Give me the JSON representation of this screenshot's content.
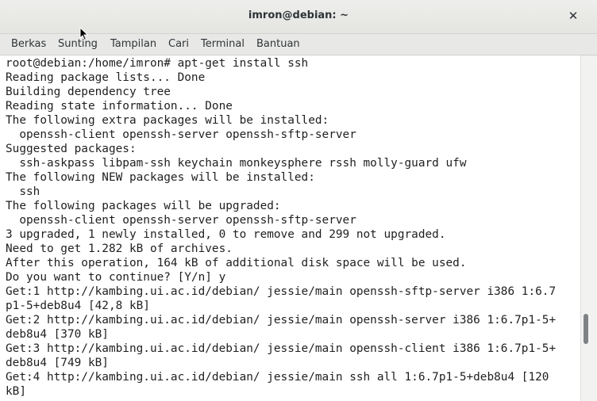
{
  "window": {
    "title": "imron@debian: ~",
    "close_label": "✕"
  },
  "menu": [
    "Berkas",
    "Sunting",
    "Tampilan",
    "Cari",
    "Terminal",
    "Bantuan"
  ],
  "terminal": {
    "lines": [
      "root@debian:/home/imron# apt-get install ssh",
      "Reading package lists... Done",
      "Building dependency tree",
      "Reading state information... Done",
      "The following extra packages will be installed:",
      "  openssh-client openssh-server openssh-sftp-server",
      "Suggested packages:",
      "  ssh-askpass libpam-ssh keychain monkeysphere rssh molly-guard ufw",
      "The following NEW packages will be installed:",
      "  ssh",
      "The following packages will be upgraded:",
      "  openssh-client openssh-server openssh-sftp-server",
      "3 upgraded, 1 newly installed, 0 to remove and 299 not upgraded.",
      "Need to get 1.282 kB of archives.",
      "After this operation, 164 kB of additional disk space will be used.",
      "Do you want to continue? [Y/n] y",
      "Get:1 http://kambing.ui.ac.id/debian/ jessie/main openssh-sftp-server i386 1:6.7",
      "p1-5+deb8u4 [42,8 kB]",
      "Get:2 http://kambing.ui.ac.id/debian/ jessie/main openssh-server i386 1:6.7p1-5+",
      "deb8u4 [370 kB]",
      "Get:3 http://kambing.ui.ac.id/debian/ jessie/main openssh-client i386 1:6.7p1-5+",
      "deb8u4 [749 kB]",
      "Get:4 http://kambing.ui.ac.id/debian/ jessie/main ssh all 1:6.7p1-5+deb8u4 [120",
      "kB]"
    ]
  }
}
